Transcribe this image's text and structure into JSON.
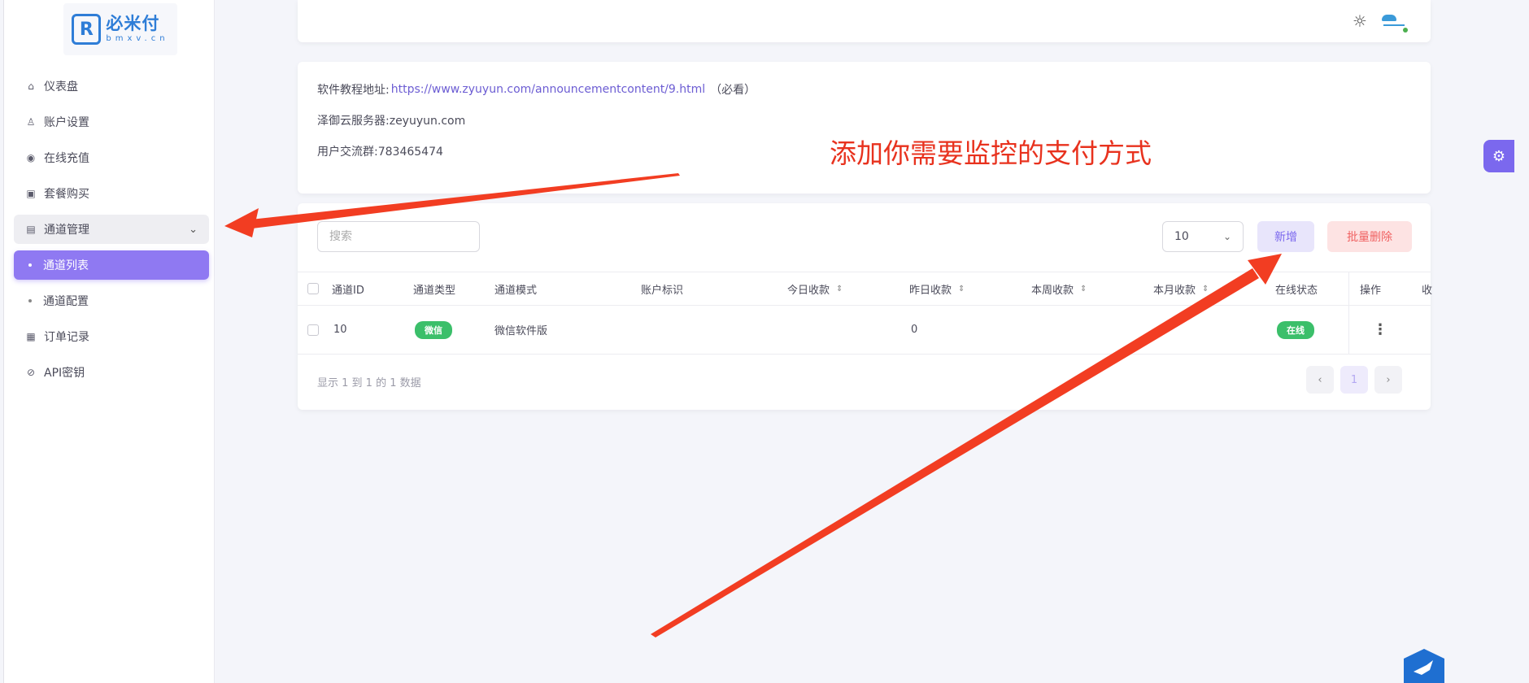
{
  "brand": {
    "name": "必米付",
    "domain": "bmxv.cn",
    "color": "#2e7dd7"
  },
  "sidebar": {
    "items": [
      {
        "label": "仪表盘",
        "icon": "home-icon"
      },
      {
        "label": "账户设置",
        "icon": "user-icon"
      },
      {
        "label": "在线充值",
        "icon": "coin-icon"
      },
      {
        "label": "套餐购买",
        "icon": "package-icon"
      },
      {
        "label": "通道管理",
        "icon": "channel-icon"
      },
      {
        "label": "通道列表",
        "icon": "dot"
      },
      {
        "label": "通道配置",
        "icon": "dot"
      },
      {
        "label": "订单记录",
        "icon": "order-icon"
      },
      {
        "label": "API密钥",
        "icon": "key-icon"
      }
    ]
  },
  "info": {
    "tutorial_label": "软件教程地址:",
    "tutorial_url": "https://www.zyuyun.com/announcementcontent/9.html",
    "tutorial_note": "（必看）",
    "server": "泽御云服务器:zeyuyun.com",
    "group": "用户交流群:783465474"
  },
  "toolbar": {
    "search_placeholder": "搜索",
    "page_size": "10",
    "add_label": "新增",
    "batch_delete_label": "批量删除"
  },
  "table": {
    "headers": [
      "通道ID",
      "通道类型",
      "通道模式",
      "账户标识",
      "今日收款",
      "昨日收款",
      "本周收款",
      "本月收款",
      "在线状态",
      "操作",
      "收"
    ],
    "rows": [
      {
        "id": "10",
        "type": "微信",
        "mode": "微信软件版",
        "account": "",
        "today": "",
        "yesterday": "0",
        "week": "",
        "month": "",
        "status": "在线",
        "action": "⋮"
      }
    ]
  },
  "footer": {
    "summary": "显示 1 到 1 的 1 数据",
    "current_page": "1",
    "prev": "‹",
    "next": "›"
  },
  "annotation": {
    "text": "添加你需要监控的支付方式",
    "color": "#e8321e"
  },
  "colors": {
    "accent": "#8f79f2",
    "danger": "#f06262",
    "success": "#3bbf6a"
  }
}
